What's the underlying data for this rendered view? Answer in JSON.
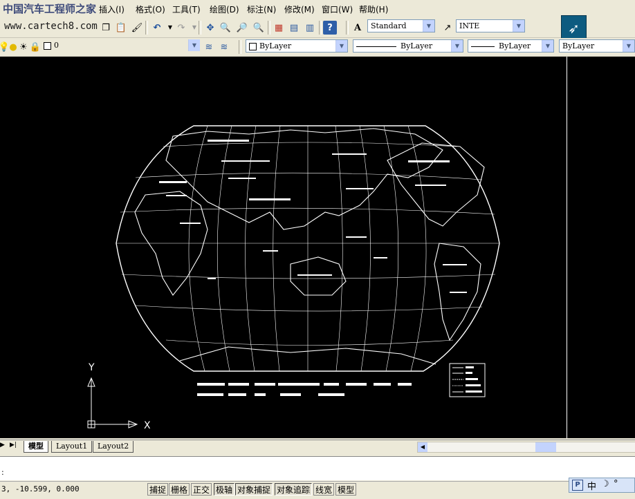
{
  "watermark": {
    "text": "中国汽车工程师之家",
    "url": "www.cartech8.com"
  },
  "menu": {
    "items": [
      "插入(I)",
      "格式(O)",
      "工具(T)",
      "绘图(D)",
      "标注(N)",
      "修改(M)",
      "窗口(W)",
      "帮助(H)"
    ]
  },
  "toolbar": {
    "text_style": "Standard",
    "dim_style": "INTE",
    "layer": "0",
    "color": "ByLayer",
    "linetype": "ByLayer",
    "lineweight": "ByLayer",
    "plot_style": "ByLayer"
  },
  "canvas": {
    "ucs_x": "X",
    "ucs_y": "Y",
    "bg_color": "#000000",
    "fg_color": "#ffffff"
  },
  "tabs": {
    "model": "模型",
    "layout1": "Layout1",
    "layout2": "Layout2"
  },
  "command": {
    "prompt": ":"
  },
  "status": {
    "coords": "3, -10.599, 0.000",
    "buttons": [
      "捕捉",
      "栅格",
      "正交",
      "极轴",
      "对象捕捉",
      "对象追踪",
      "线宽",
      "模型"
    ]
  },
  "tray": {
    "items": [
      "中"
    ]
  }
}
